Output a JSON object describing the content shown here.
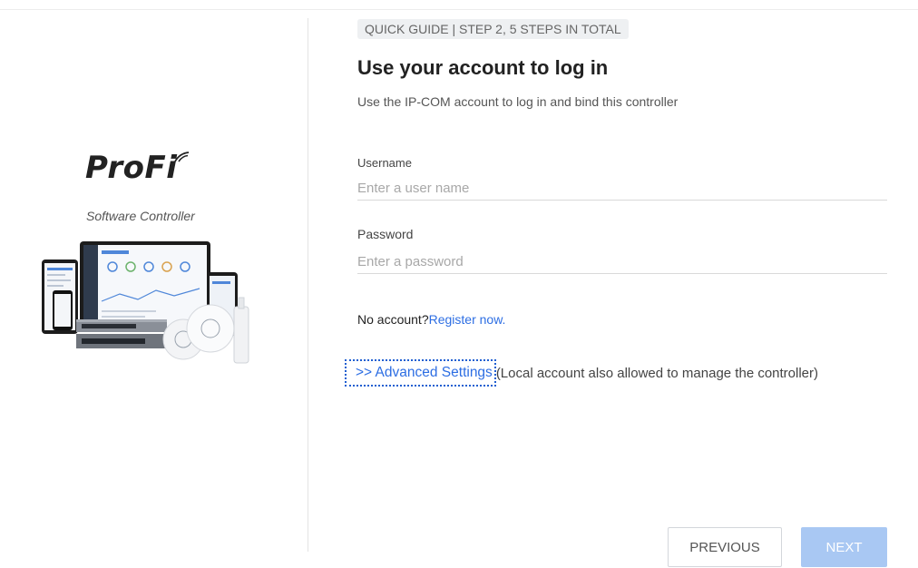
{
  "brand": {
    "logo_text": "ProFi",
    "subtitle": "Software Controller"
  },
  "step": {
    "badge": "QUICK GUIDE | STEP 2, 5 STEPS IN TOTAL"
  },
  "main": {
    "title": "Use your account to log in",
    "subtitle": "Use the IP-COM account to log in and bind this controller"
  },
  "form": {
    "username": {
      "label": "Username",
      "placeholder": "Enter a user name",
      "value": ""
    },
    "password": {
      "label": "Password",
      "placeholder": "Enter a password",
      "value": ""
    }
  },
  "register": {
    "prompt": "No account?",
    "link": "Register now."
  },
  "advanced": {
    "link": ">> Advanced Settings",
    "note": "(Local account also allowed to manage the controller)"
  },
  "buttons": {
    "previous": "PREVIOUS",
    "next": "NEXT"
  },
  "colors": {
    "link": "#2d6ee3",
    "next_button_disabled": "#a9c8f3"
  },
  "icons": {
    "logo_wifi": "wifi-arc-icon",
    "devices": "devices-illustration"
  }
}
